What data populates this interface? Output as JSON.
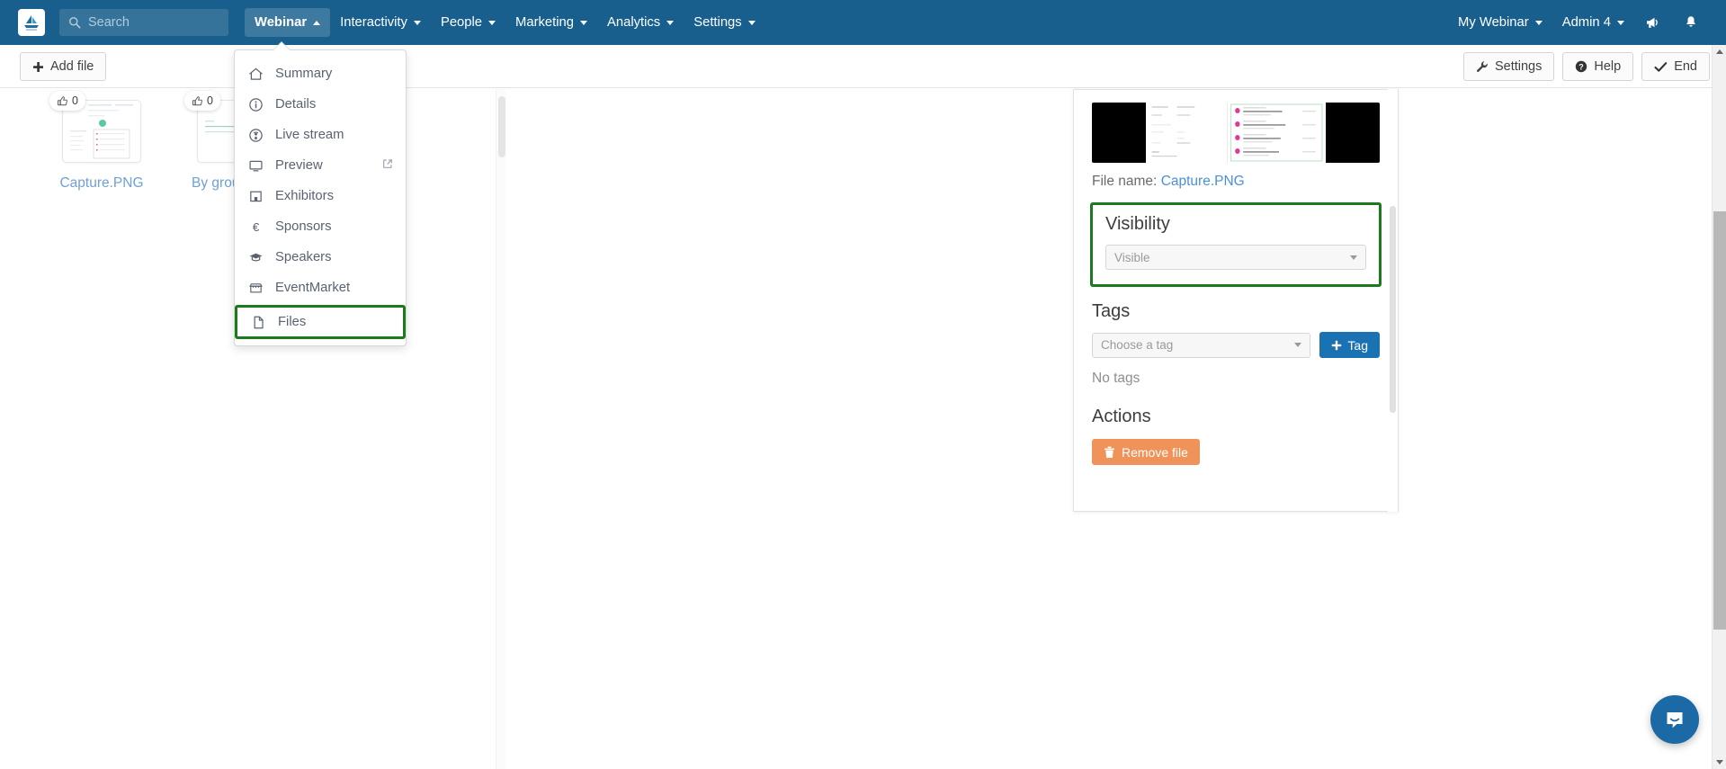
{
  "navbar": {
    "logo_icon": "sailboat-logo-icon",
    "search": {
      "placeholder": "Search",
      "value": ""
    },
    "items": [
      {
        "label": "Webinar",
        "icon": "chevron-up-icon",
        "active": true
      },
      {
        "label": "Interactivity",
        "icon": "chevron-down-icon",
        "active": false
      },
      {
        "label": "People",
        "icon": "chevron-down-icon",
        "active": false
      },
      {
        "label": "Marketing",
        "icon": "chevron-down-icon",
        "active": false
      },
      {
        "label": "Analytics",
        "icon": "chevron-down-icon",
        "active": false
      },
      {
        "label": "Settings",
        "icon": "chevron-down-icon",
        "active": false
      }
    ],
    "right_items": [
      {
        "label": "My Webinar",
        "icon": "chevron-down-icon"
      },
      {
        "label": "Admin 4",
        "icon": "chevron-down-icon"
      }
    ],
    "announce_icon": "megaphone-icon",
    "bell_icon": "bell-icon",
    "background_color": "#185f8d"
  },
  "toolbar": {
    "add_file_label": "Add file",
    "add_file_icon": "plus-icon",
    "settings_label": "Settings",
    "settings_icon": "wrench-icon",
    "help_label": "Help",
    "help_icon": "question-circle-icon",
    "end_label": "End",
    "end_icon": "check-icon"
  },
  "webinar_dropdown": {
    "items": [
      {
        "label": "Summary",
        "icon": "home-icon",
        "highlighted": false,
        "external": false
      },
      {
        "label": "Details",
        "icon": "info-circle-icon",
        "highlighted": false,
        "external": false
      },
      {
        "label": "Live stream",
        "icon": "broadcast-icon",
        "highlighted": false,
        "external": false
      },
      {
        "label": "Preview",
        "icon": "monitor-icon",
        "highlighted": false,
        "external": true
      },
      {
        "label": "Exhibitors",
        "icon": "booth-icon",
        "highlighted": false,
        "external": false
      },
      {
        "label": "Sponsors",
        "icon": "euro-icon",
        "highlighted": false,
        "external": false
      },
      {
        "label": "Speakers",
        "icon": "graduation-cap-icon",
        "highlighted": false,
        "external": false
      },
      {
        "label": "EventMarket",
        "icon": "storefront-icon",
        "highlighted": false,
        "external": false
      },
      {
        "label": "Files",
        "icon": "file-icon",
        "highlighted": true,
        "external": false
      }
    ],
    "highlight_color": "#1c7a1c"
  },
  "files": {
    "items": [
      {
        "name": "Capture.PNG",
        "likes": "0",
        "like_icon": "thumbs-up-icon"
      },
      {
        "name": "By group.PNG",
        "likes": "0",
        "like_icon": "thumbs-up-icon"
      }
    ]
  },
  "detail_panel": {
    "file_name_label": "File name:",
    "file_name_value": "Capture.PNG",
    "visibility": {
      "title": "Visibility",
      "selected": "Visible",
      "dropdown_icon": "chevron-down-icon"
    },
    "tags": {
      "title": "Tags",
      "select_placeholder": "Choose a tag",
      "dropdown_icon": "chevron-down-icon",
      "add_button_label": "Tag",
      "add_button_icon": "plus-icon",
      "empty_text": "No tags"
    },
    "actions": {
      "title": "Actions",
      "remove_label": "Remove file",
      "remove_icon": "trash-icon",
      "remove_color": "#f0935a"
    }
  },
  "chat": {
    "icon": "chat-bubble-icon",
    "color": "#1b6aa5"
  }
}
